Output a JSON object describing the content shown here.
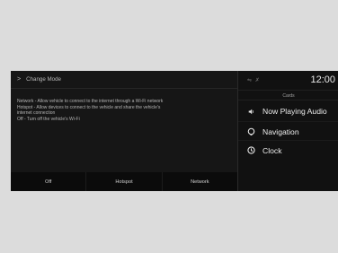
{
  "left": {
    "header_chevron": ">",
    "title": "Change Mode",
    "description_lines": [
      "Network - Allow vehicle to connect to the internet through a Wi-Fi network",
      "Hotspot - Allow devices to connect to the vehicle and share the vehicle's",
      "internet connection",
      "Off - Turn off the vehicle's Wi-Fi"
    ],
    "buttons": [
      "Off",
      "Hotspot",
      "Network"
    ]
  },
  "right": {
    "clock": "12:00",
    "cards_title": "Cards",
    "cards": [
      {
        "label": "Now Playing Audio",
        "icon": "speaker-icon"
      },
      {
        "label": "Navigation",
        "icon": "navigation-pin-icon"
      },
      {
        "label": "Clock",
        "icon": "clock-icon"
      }
    ],
    "status_icons": [
      "phone-signal-icon",
      "bluetooth-icon"
    ]
  }
}
